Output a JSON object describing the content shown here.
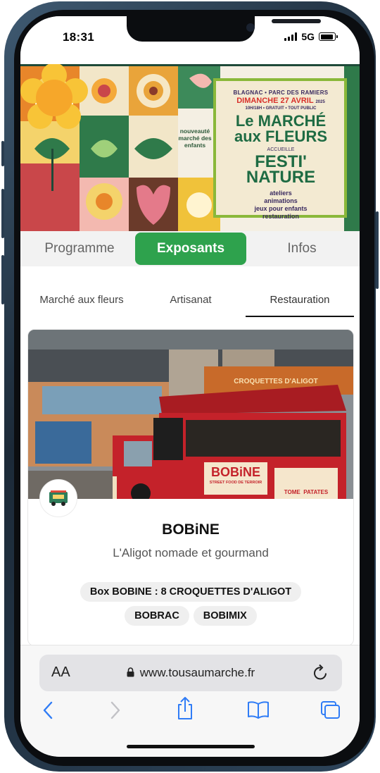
{
  "status": {
    "time": "18:31",
    "network": "5G",
    "battery_level": 0.9
  },
  "banner": {
    "location": "BLAGNAC • PARC DES RAMIERS",
    "date": "DIMANCHE 27 AVRIL",
    "year": "2025",
    "hours": "10H/18H • GRATUIT • TOUT PUBLIC",
    "title_line1": "Le MARCHÉ",
    "title_line2": "aux FLEURS",
    "accueille": "ACCUEILLE",
    "festi_line1": "FESTI'",
    "festi_line2": "NATURE",
    "activities": [
      "ateliers",
      "animations",
      "jeux pour enfants",
      "restauration"
    ],
    "badge_line1": "nouveauté",
    "badge_line2": "marché des",
    "badge_line3": "enfants"
  },
  "main_tabs": [
    {
      "label": "Programme",
      "active": false
    },
    {
      "label": "Exposants",
      "active": true
    },
    {
      "label": "Infos",
      "active": false
    }
  ],
  "sub_tabs": [
    {
      "label": "Marché aux fleurs",
      "active": false
    },
    {
      "label": "Artisanat",
      "active": false
    },
    {
      "label": "Restauration",
      "active": true
    }
  ],
  "vendor": {
    "truck_sign": "BOBiNE",
    "truck_sub": "STREET FOOD DE TERROIR",
    "truck_side1": "TOME",
    "truck_side2": "PATATES",
    "awning_text": "CROQUETTES D'ALIGOT",
    "name": "BOBiNE",
    "tagline": "L'Aligot nomade et gourmand",
    "products": [
      "Box BOBINE : 8 CROQUETTES D'ALIGOT",
      "BOBRAC",
      "BOBIMIX"
    ]
  },
  "browser": {
    "text_size_label": "AA",
    "url": "www.tousaumarche.fr"
  },
  "colors": {
    "accent": "#2ea24d",
    "banner_green": "#1e6b43",
    "banner_red": "#d8302a",
    "truck_red": "#c4222a"
  },
  "icons": [
    "back-chevron-icon",
    "forward-chevron-icon",
    "share-icon",
    "bookmarks-icon",
    "tabs-icon",
    "lock-icon",
    "reload-icon"
  ]
}
